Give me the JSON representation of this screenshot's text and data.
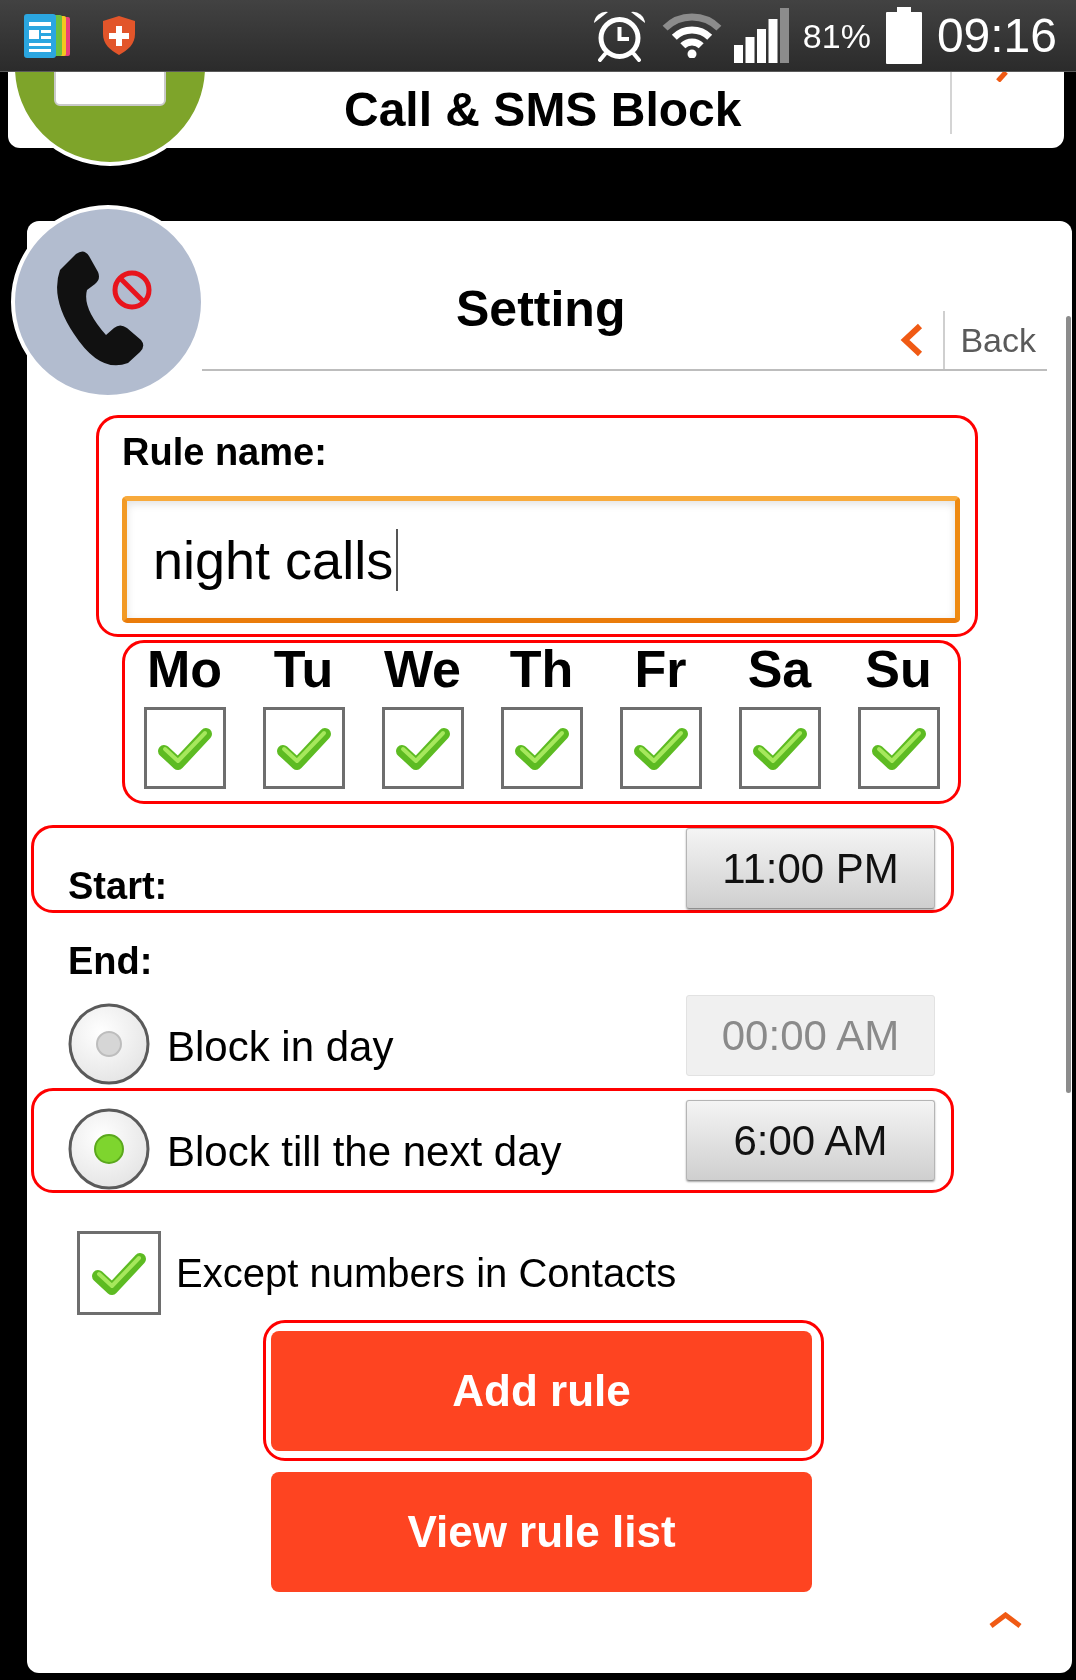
{
  "status_bar": {
    "battery_percent": "81%",
    "time": "09:16"
  },
  "background_card": {
    "title": "Call & SMS Block"
  },
  "header": {
    "title": "Setting",
    "back_label": "Back"
  },
  "rule_name": {
    "label": "Rule name:",
    "value": "night calls",
    "focused": true,
    "highlighted": true
  },
  "days": {
    "highlighted": true,
    "items": [
      {
        "label": "Mo",
        "checked": true
      },
      {
        "label": "Tu",
        "checked": true
      },
      {
        "label": "We",
        "checked": true
      },
      {
        "label": "Th",
        "checked": true
      },
      {
        "label": "Fr",
        "checked": true
      },
      {
        "label": "Sa",
        "checked": true
      },
      {
        "label": "Su",
        "checked": true
      }
    ]
  },
  "start": {
    "label": "Start:",
    "time": "11:00 PM",
    "highlighted": true
  },
  "end": {
    "label": "End:",
    "options": [
      {
        "label": "Block in day",
        "selected": false,
        "time": "00:00 AM",
        "time_disabled": true,
        "highlighted": false
      },
      {
        "label": "Block till the next day",
        "selected": true,
        "time": "6:00 AM",
        "time_disabled": false,
        "highlighted": true
      }
    ]
  },
  "except_contacts": {
    "label": "Except numbers in Contacts",
    "checked": true
  },
  "buttons": [
    {
      "label": "Add rule",
      "highlighted": true
    },
    {
      "label": "View rule list",
      "highlighted": false
    }
  ]
}
